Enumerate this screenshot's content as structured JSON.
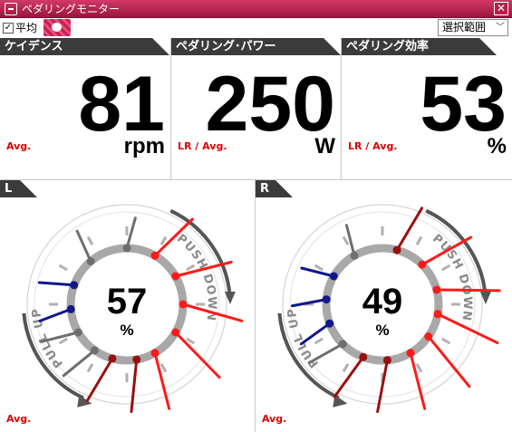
{
  "window": {
    "title": "ペダリングモニター",
    "close_glyph": "✕"
  },
  "toolbar": {
    "average_checkbox": {
      "checked": true,
      "label": "平均"
    },
    "range_select": {
      "value": "選択範囲"
    }
  },
  "metrics": [
    {
      "title": "ケイデンス",
      "value": "81",
      "unit": "rpm",
      "sub": "Avg."
    },
    {
      "title": "ペダリング･パワー",
      "value": "250",
      "unit": "W",
      "sub": "LR / Avg."
    },
    {
      "title": "ペダリング効率",
      "value": "53",
      "unit": "%",
      "sub": "LR / Avg."
    }
  ],
  "gauges": [
    {
      "side": "L",
      "value": "57",
      "unit": "%",
      "sub": "Avg.",
      "label_left": "PULL UP",
      "label_right": "PUSH DOWN",
      "vectors": [
        {
          "angle": 30,
          "len": 0.95,
          "color": "red"
        },
        {
          "angle": 60,
          "len": 1.1,
          "color": "red"
        },
        {
          "angle": 90,
          "len": 1.2,
          "color": "red"
        },
        {
          "angle": 120,
          "len": 1.25,
          "color": "red"
        },
        {
          "angle": 150,
          "len": 1.1,
          "color": "red"
        },
        {
          "angle": 170,
          "len": 0.95,
          "color": "darkred"
        },
        {
          "angle": 195,
          "len": 0.85,
          "color": "darkred"
        },
        {
          "angle": 215,
          "len": 0.6,
          "color": "gray"
        },
        {
          "angle": 240,
          "len": 0.55,
          "color": "gray"
        },
        {
          "angle": 265,
          "len": 0.4,
          "color": "blue"
        },
        {
          "angle": 290,
          "len": 0.45,
          "color": "blue"
        },
        {
          "angle": 320,
          "len": 0.4,
          "color": "gray"
        },
        {
          "angle": 0,
          "len": 0.35,
          "color": "gray"
        }
      ]
    },
    {
      "side": "R",
      "value": "49",
      "unit": "%",
      "sub": "Avg.",
      "label_left": "PULL UP",
      "label_right": "PUSH DOWN",
      "vectors": [
        {
          "angle": 15,
          "len": 0.85,
          "color": "darkred"
        },
        {
          "angle": 45,
          "len": 1.05,
          "color": "red"
        },
        {
          "angle": 75,
          "len": 1.25,
          "color": "red"
        },
        {
          "angle": 100,
          "len": 1.35,
          "color": "red"
        },
        {
          "angle": 125,
          "len": 1.3,
          "color": "red"
        },
        {
          "angle": 150,
          "len": 1.1,
          "color": "red"
        },
        {
          "angle": 175,
          "len": 0.95,
          "color": "darkred"
        },
        {
          "angle": 200,
          "len": 0.85,
          "color": "darkred"
        },
        {
          "angle": 225,
          "len": 0.55,
          "color": "gray"
        },
        {
          "angle": 250,
          "len": 0.45,
          "color": "blue"
        },
        {
          "angle": 275,
          "len": 0.45,
          "color": "blue"
        },
        {
          "angle": 300,
          "len": 0.4,
          "color": "blue"
        },
        {
          "angle": 330,
          "len": 0.35,
          "color": "gray"
        }
      ]
    }
  ],
  "colors": {
    "accent": "#b81e4c",
    "panel_header": "#3b3b3b",
    "avg_label": "#e00000",
    "vector_red": "#ff1a1a",
    "vector_darkred": "#9a0f0f",
    "vector_blue": "#10188c",
    "vector_gray": "#6e6e6e"
  }
}
